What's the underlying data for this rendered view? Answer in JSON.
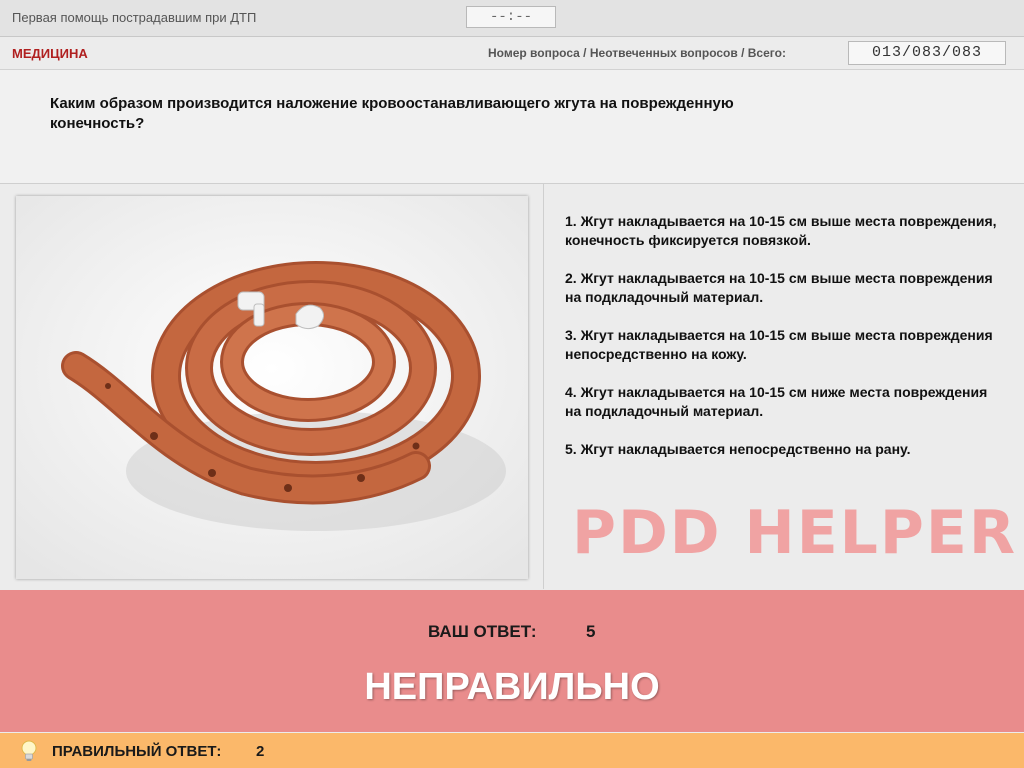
{
  "header": {
    "title": "Первая помощь пострадавшим при ДТП",
    "timer": "--:--"
  },
  "category": {
    "name": "МЕДИЦИНА",
    "counter_label": "Номер вопроса / Неотвеченных вопросов / Всего:",
    "counter_value": "013/083/083"
  },
  "question": {
    "text": "Каким образом производится наложение кровоостанавливающего жгута на поврежденную конечность?"
  },
  "image": {
    "subject": "rubber-tourniquet"
  },
  "answers": [
    {
      "label": "1.  Жгут накладывается на 10-15 см выше места повреждения, конечность фиксируется повязкой."
    },
    {
      "label": "2.  Жгут накладывается на 10-15 см выше места повреждения на подкладочный материал."
    },
    {
      "label": "3.  Жгут накладывается на 10-15 см выше места повреждения непосредственно на кожу."
    },
    {
      "label": "4.  Жгут накладывается на 10-15 см ниже места повреждения на подкладочный материал."
    },
    {
      "label": "5.  Жгут накладывается непосредственно на рану."
    }
  ],
  "watermark": "PDD HELPER",
  "result": {
    "your_answer_label": "ВАШ  ОТВЕТ:",
    "your_answer_value": "5",
    "verdict": "НЕПРАВИЛЬНО"
  },
  "correct": {
    "label": "ПРАВИЛЬНЫЙ ОТВЕТ:",
    "value": "2"
  },
  "colors": {
    "result_bg": "#e98c8c",
    "correct_bg": "#fbb86a",
    "category": "#b02020",
    "watermark": "#f0a3a3"
  }
}
